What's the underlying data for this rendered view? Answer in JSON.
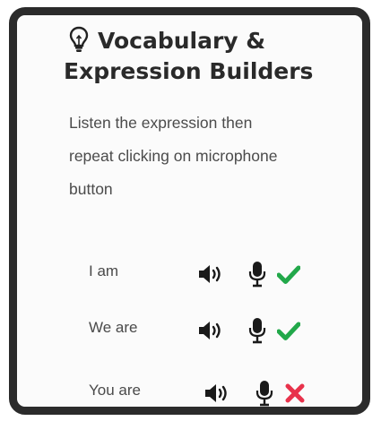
{
  "card": {
    "title_line1": "Vocabulary &",
    "title_line2": "Expression Builders",
    "title_icon": "lightbulb-icon",
    "description_line1": "Listen the expression then",
    "description_line2": "repeat clicking on microphone",
    "description_line3": "button"
  },
  "expressions": [
    {
      "text": "I am",
      "audio_icon": "speaker-icon",
      "record_icon": "microphone-icon",
      "status_icon": "checkmark-icon",
      "status": "correct"
    },
    {
      "text": "We are",
      "audio_icon": "speaker-icon",
      "record_icon": "microphone-icon",
      "status_icon": "checkmark-icon",
      "status": "correct"
    },
    {
      "text": "You are",
      "audio_icon": "speaker-icon",
      "record_icon": "microphone-icon",
      "status_icon": "cross-icon",
      "status": "incorrect"
    }
  ],
  "colors": {
    "correct": "#22a84a",
    "incorrect": "#e8324b",
    "icon": "#1a1a1a",
    "frame": "#2b2b2b"
  }
}
